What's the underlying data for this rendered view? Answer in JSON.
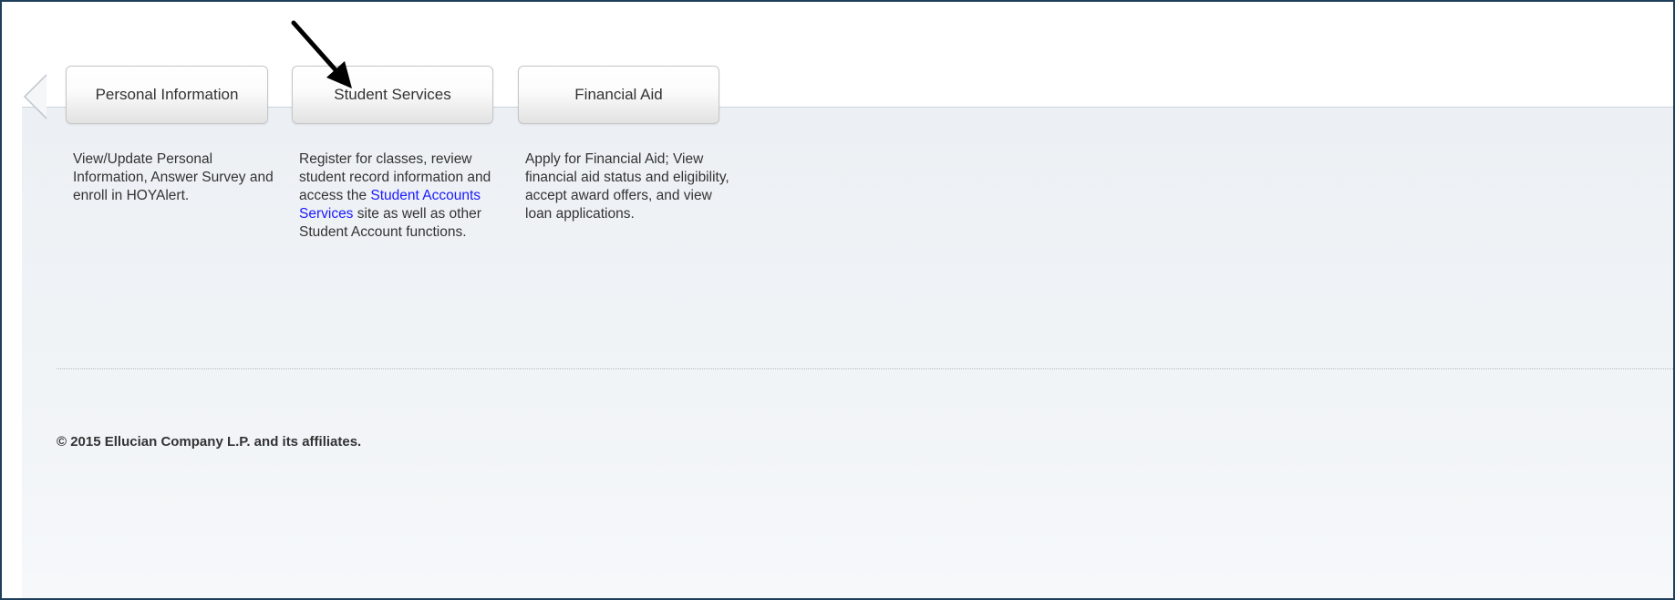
{
  "tabs": [
    {
      "label": "Personal Information",
      "description": "View/Update Personal Information, Answer Survey and enroll in HOYAlert."
    },
    {
      "label": "Student Services",
      "description_before": "Register for classes, review student record information and access the ",
      "link_text": "Student Accounts Services",
      "description_after": " site as well as other Student Account functions."
    },
    {
      "label": "Financial Aid",
      "description": "Apply for Financial Aid; View financial aid status and eligibility, accept award offers, and view loan applications."
    }
  ],
  "nav": {
    "prev_icon": "chevron-left-icon"
  },
  "annotation": {
    "icon": "arrow-pointer-icon",
    "target": "Student Services"
  },
  "footer": {
    "copyright": "© 2015 Ellucian Company L.P. and its affiliates."
  },
  "colors": {
    "frame_border": "#1f3e5a",
    "content_bg": "#ecf0f4",
    "link": "#1a1aff",
    "text": "#333333"
  }
}
